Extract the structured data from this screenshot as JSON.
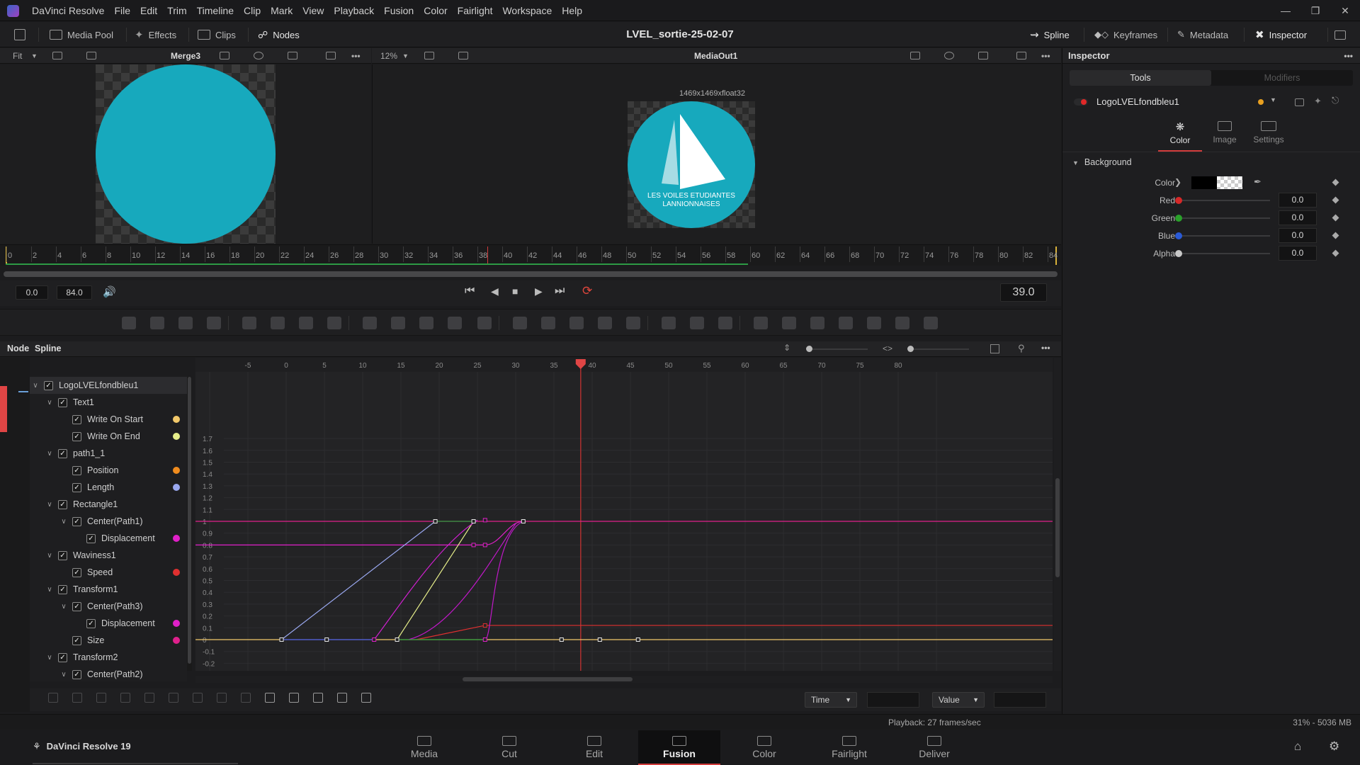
{
  "app": {
    "menu": [
      "DaVinci Resolve",
      "File",
      "Edit",
      "Trim",
      "Timeline",
      "Clip",
      "Mark",
      "View",
      "Playback",
      "Fusion",
      "Color",
      "Fairlight",
      "Workspace",
      "Help"
    ]
  },
  "toolbar": {
    "media_pool": "Media Pool",
    "effects": "Effects",
    "clips": "Clips",
    "nodes": "Nodes",
    "title": "LVEL_sortie-25-02-07",
    "spline": "Spline",
    "keyframes": "Keyframes",
    "metadata": "Metadata",
    "inspector": "Inspector"
  },
  "viewer_left": {
    "fit": "Fit",
    "title": "Merge3"
  },
  "viewer_right": {
    "zoom": "12%",
    "title": "MediaOut1",
    "resolution": "1469x1469xfloat32"
  },
  "logo": {
    "line1": "LES VOILES ETUDIANTES",
    "line2": "LANNIONNAISES",
    "color": "#17a9bd"
  },
  "ruler": {
    "labels": [
      "0",
      "2",
      "4",
      "6",
      "8",
      "10",
      "12",
      "14",
      "16",
      "18",
      "20",
      "22",
      "24",
      "26",
      "28",
      "30",
      "32",
      "34",
      "36",
      "38",
      "40",
      "42",
      "44",
      "46",
      "48",
      "50",
      "52",
      "54",
      "56",
      "58",
      "60",
      "62",
      "64",
      "66",
      "68",
      "70",
      "72",
      "74",
      "76",
      "78",
      "80",
      "82",
      "84"
    ]
  },
  "transport": {
    "start": "0.0",
    "end": "84.0",
    "current": "39.0"
  },
  "spline_panel": {
    "tab_node": "Node",
    "tab_spline": "Spline",
    "tree": [
      {
        "label": "LogoLVELfondbleu1",
        "level": 0,
        "expand": true
      },
      {
        "label": "Text1",
        "level": 1,
        "expand": true
      },
      {
        "label": "Write On Start",
        "level": 2,
        "dot": "#f2c86a"
      },
      {
        "label": "Write On End",
        "level": 2,
        "dot": "#e6ee8a"
      },
      {
        "label": "path1_1",
        "level": 1,
        "expand": true
      },
      {
        "label": "Position",
        "level": 2,
        "dot": "#f08c1e"
      },
      {
        "label": "Length",
        "level": 2,
        "dot": "#9aa8f0"
      },
      {
        "label": "Rectangle1",
        "level": 1,
        "expand": true
      },
      {
        "label": "Center(Path1)",
        "level": 2,
        "expand": true
      },
      {
        "label": "Displacement",
        "level": 3,
        "dot": "#e020c8"
      },
      {
        "label": "Waviness1",
        "level": 1,
        "expand": true
      },
      {
        "label": "Speed",
        "level": 2,
        "dot": "#e03030"
      },
      {
        "label": "Transform1",
        "level": 1,
        "expand": true
      },
      {
        "label": "Center(Path3)",
        "level": 2,
        "expand": true
      },
      {
        "label": "Displacement",
        "level": 3,
        "dot": "#e020c8"
      },
      {
        "label": "Size",
        "level": 2,
        "dot": "#e0208c"
      },
      {
        "label": "Transform2",
        "level": 1,
        "expand": true
      },
      {
        "label": "Center(Path2)",
        "level": 2,
        "expand": true
      }
    ],
    "x_labels": [
      "-5",
      "0",
      "5",
      "10",
      "15",
      "20",
      "25",
      "30",
      "35",
      "40",
      "45",
      "50",
      "55",
      "60",
      "65",
      "70",
      "75",
      "80"
    ],
    "y_labels": [
      "1.7",
      "1.6",
      "1.5",
      "1.4",
      "1.3",
      "1.2",
      "1.1",
      "1",
      "0.9",
      "0.8",
      "0.7",
      "0.6",
      "0.5",
      "0.4",
      "0.3",
      "0.2",
      "0.1",
      "0",
      "-0.1",
      "-0.2"
    ],
    "time_select": "Time",
    "value_select": "Value"
  },
  "inspector": {
    "title": "Inspector",
    "tab_tools": "Tools",
    "tab_modifiers": "Modifiers",
    "node_name": "LogoLVELfondbleu1",
    "subtab_color": "Color",
    "subtab_image": "Image",
    "subtab_settings": "Settings",
    "section": "Background",
    "color_label": "Color",
    "sliders": [
      {
        "name": "Red",
        "value": "0.0",
        "knob": "#d62828"
      },
      {
        "name": "Green",
        "value": "0.0",
        "knob": "#2aa02a"
      },
      {
        "name": "Blue",
        "value": "0.0",
        "knob": "#2a5ad6"
      },
      {
        "name": "Alpha",
        "value": "0.0",
        "knob": "#c8c8c8"
      }
    ]
  },
  "status": {
    "playback": "Playback: 27 frames/sec",
    "memory": "31% - 5036 MB"
  },
  "pages": {
    "brand": "DaVinci Resolve 19",
    "items": [
      "Media",
      "Cut",
      "Edit",
      "Fusion",
      "Color",
      "Fairlight",
      "Deliver"
    ],
    "active": "Fusion"
  }
}
